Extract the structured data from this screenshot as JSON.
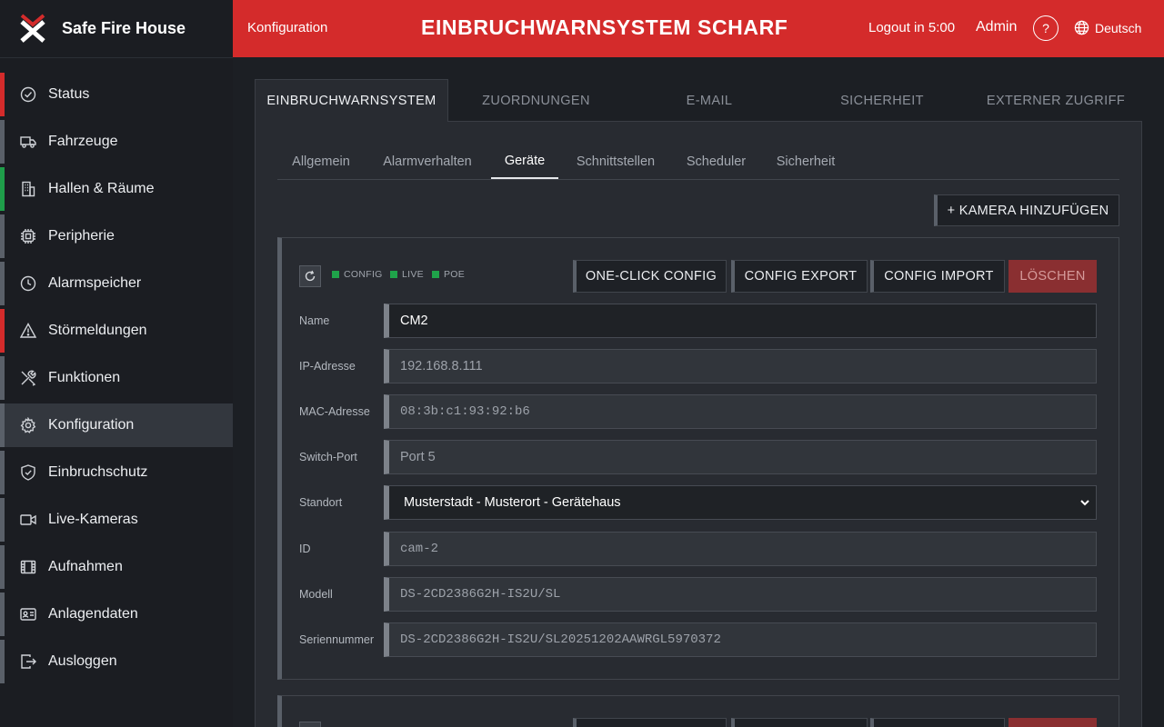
{
  "brand": {
    "name": "Safe Fire House"
  },
  "sidebar": {
    "items": [
      {
        "label": "Status",
        "icon": "check-circle-icon",
        "accent": "#d42b2b"
      },
      {
        "label": "Fahrzeuge",
        "icon": "truck-icon",
        "accent": "#5a6069"
      },
      {
        "label": "Hallen & Räume",
        "icon": "building-icon",
        "accent": "#1f9e4a"
      },
      {
        "label": "Peripherie",
        "icon": "chip-icon",
        "accent": "#5a6069"
      },
      {
        "label": "Alarmspeicher",
        "icon": "clock-icon",
        "accent": "#5a6069"
      },
      {
        "label": "Störmeldungen",
        "icon": "warning-icon",
        "accent": "#d42b2b"
      },
      {
        "label": "Funktionen",
        "icon": "tools-icon",
        "accent": "#5a6069"
      },
      {
        "label": "Konfiguration",
        "icon": "gear-icon",
        "accent": "#5a6069",
        "active": true
      },
      {
        "label": "Einbruchschutz",
        "icon": "shield-icon",
        "accent": "#5a6069"
      },
      {
        "label": "Live-Kameras",
        "icon": "camera-icon",
        "accent": "#5a6069"
      },
      {
        "label": "Aufnahmen",
        "icon": "film-icon",
        "accent": "#5a6069"
      },
      {
        "label": "Anlagendaten",
        "icon": "id-card-icon",
        "accent": "#5a6069"
      },
      {
        "label": "Ausloggen",
        "icon": "logout-icon",
        "accent": "#5a6069"
      }
    ]
  },
  "header": {
    "section": "Konfiguration",
    "title": "EINBRUCHWARNSYSTEM SCHARF",
    "logout_timer": "Logout in 5:00",
    "user": "Admin",
    "help": "?",
    "language": "Deutsch",
    "color": "#d42b2b"
  },
  "main_tabs": [
    "EINBRUCHWARNSYSTEM",
    "ZUORDNUNGEN",
    "E-MAIL",
    "SICHERHEIT",
    "EXTERNER ZUGRIFF"
  ],
  "sub_tabs": [
    "Allgemein",
    "Alarmverhalten",
    "Geräte",
    "Schnittstellen",
    "Scheduler",
    "Sicherheit"
  ],
  "actions": {
    "add_camera": "+ KAMERA HINZUFÜGEN"
  },
  "device": {
    "indicators": [
      "CONFIG",
      "LIVE",
      "POE"
    ],
    "buttons": {
      "one_click": "ONE-CLICK CONFIG",
      "export": "CONFIG EXPORT",
      "import": "CONFIG IMPORT",
      "delete": "LÖSCHEN"
    },
    "fields": {
      "name": {
        "label": "Name",
        "value": "CM2"
      },
      "ip": {
        "label": "IP-Adresse",
        "value": "192.168.8.111"
      },
      "mac": {
        "label": "MAC-Adresse",
        "value": "08:3b:c1:93:92:b6"
      },
      "switch_port": {
        "label": "Switch-Port",
        "value": "Port 5"
      },
      "location": {
        "label": "Standort",
        "value": "Musterstadt - Musterort - Gerätehaus"
      },
      "id": {
        "label": "ID",
        "value": "cam-2"
      },
      "model": {
        "label": "Modell",
        "value": "DS-2CD2386G2H-IS2U/SL"
      },
      "serial": {
        "label": "Seriennummer",
        "value": "DS-2CD2386G2H-IS2U/SL20251202AAWRGL5970372"
      }
    }
  }
}
